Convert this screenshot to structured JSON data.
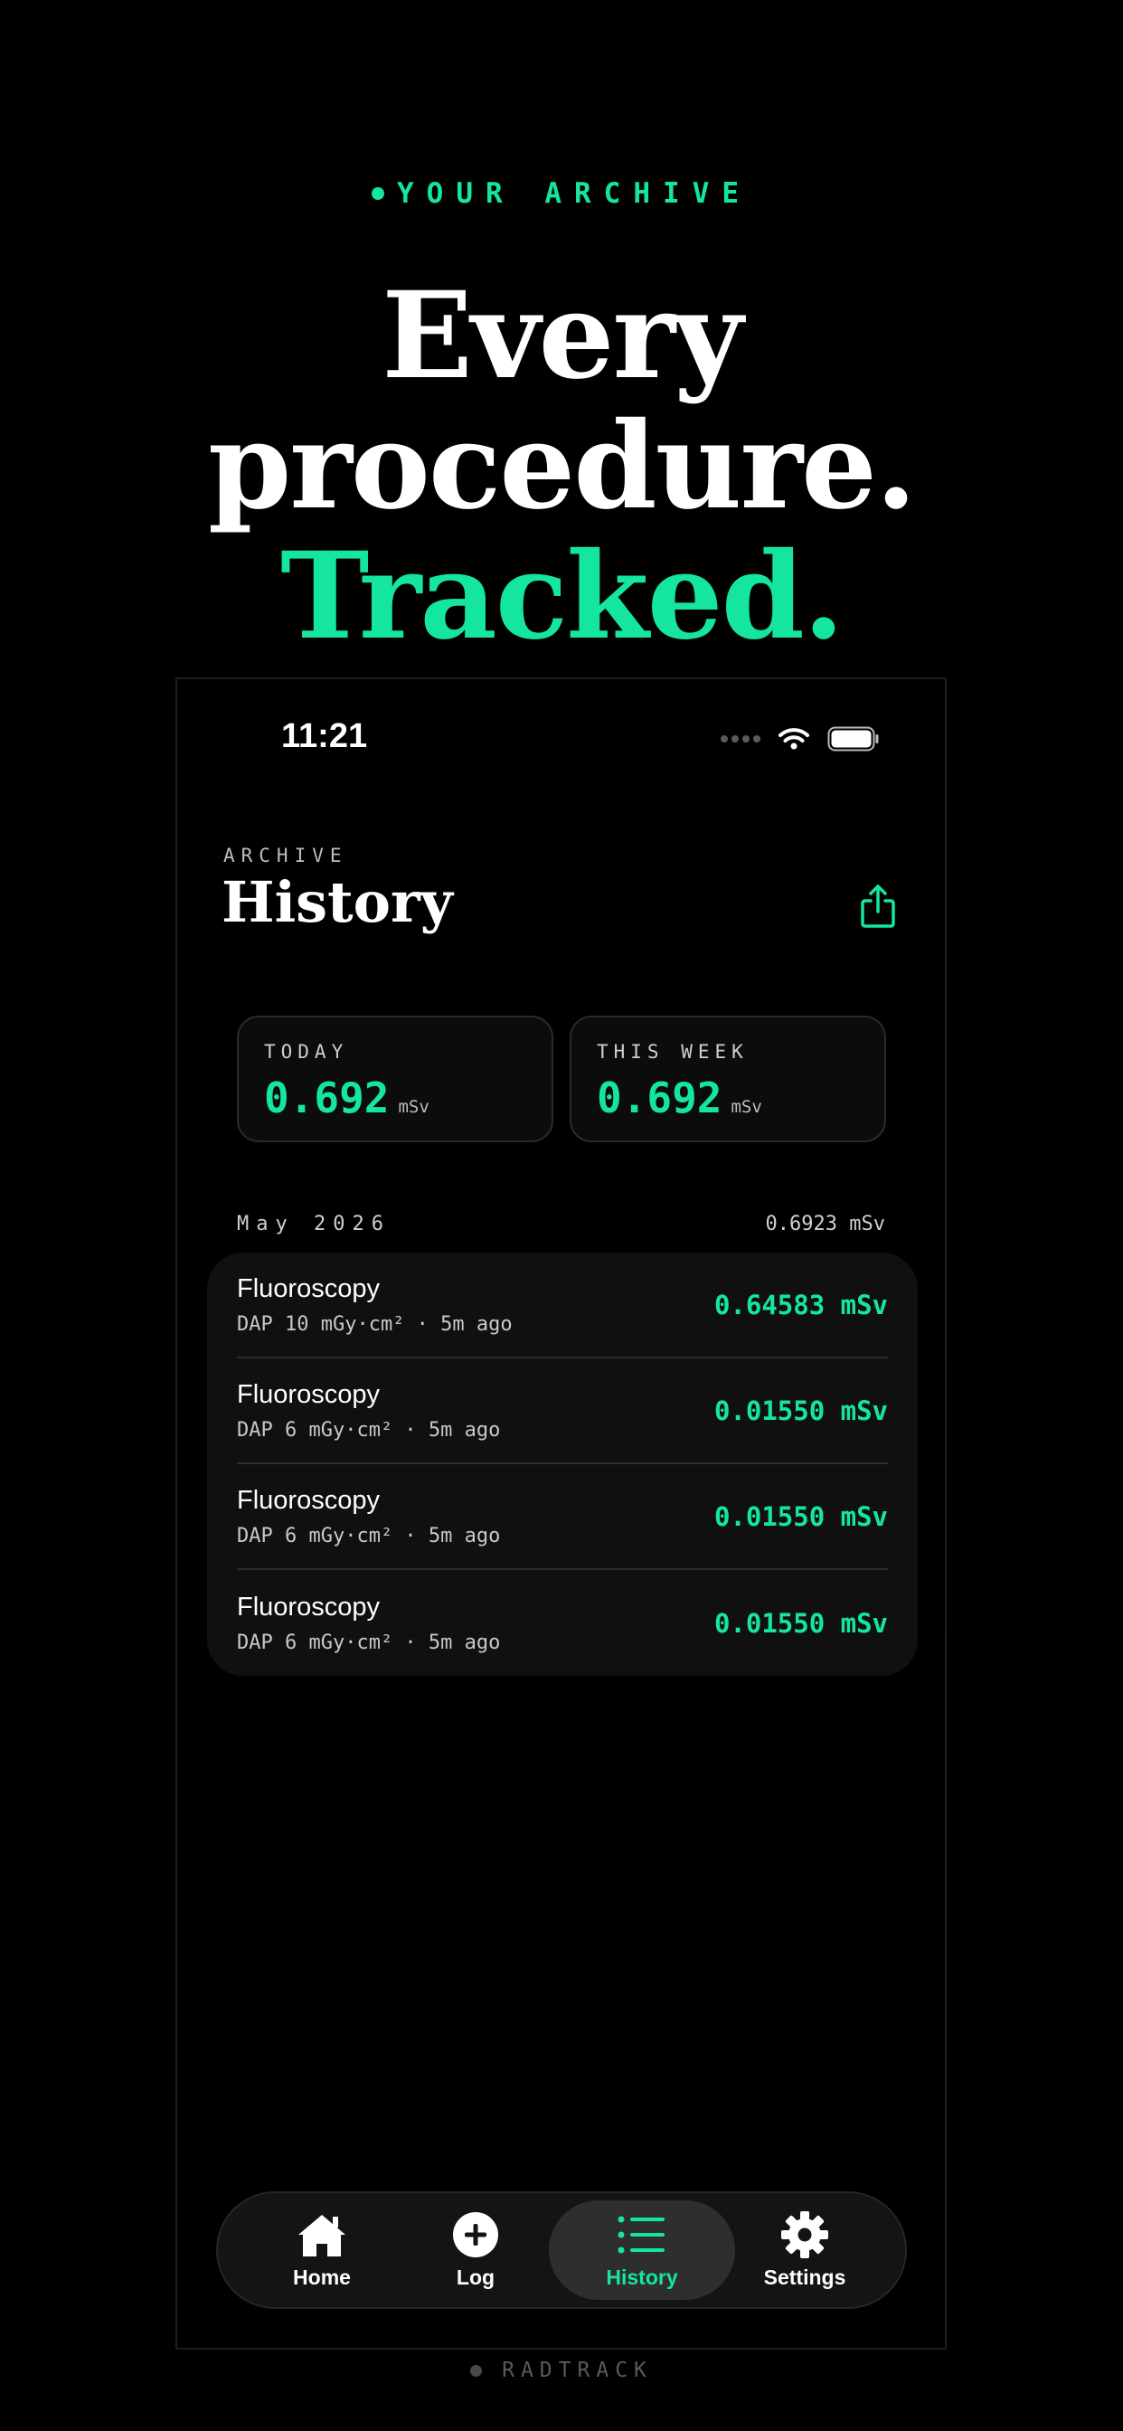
{
  "hero": {
    "eyebrow": "YOUR ARCHIVE",
    "line1": "Every",
    "line2": "procedure.",
    "line3": "Tracked."
  },
  "status_bar": {
    "time": "11:21"
  },
  "header": {
    "eyebrow": "ARCHIVE",
    "title": "History",
    "share_icon": "share-icon"
  },
  "stats": [
    {
      "label": "TODAY",
      "value": "0.692",
      "unit": "mSv"
    },
    {
      "label": "THIS WEEK",
      "value": "0.692",
      "unit": "mSv"
    }
  ],
  "month": {
    "label": "May 2026",
    "total": "0.6923 mSv"
  },
  "entries": [
    {
      "name": "Fluoroscopy",
      "meta": "DAP 10 mGy·cm² · 5m ago",
      "dose": "0.64583 mSv"
    },
    {
      "name": "Fluoroscopy",
      "meta": "DAP 6 mGy·cm² · 5m ago",
      "dose": "0.01550 mSv"
    },
    {
      "name": "Fluoroscopy",
      "meta": "DAP 6 mGy·cm² · 5m ago",
      "dose": "0.01550 mSv"
    },
    {
      "name": "Fluoroscopy",
      "meta": "DAP 6 mGy·cm² · 5m ago",
      "dose": "0.01550 mSv"
    }
  ],
  "tabs": [
    {
      "label": "Home",
      "icon": "house-icon",
      "active": false
    },
    {
      "label": "Log",
      "icon": "plus-circle-icon",
      "active": false
    },
    {
      "label": "History",
      "icon": "list-icon",
      "active": true
    },
    {
      "label": "Settings",
      "icon": "gear-icon",
      "active": false
    }
  ],
  "footer": {
    "brand": "RADTRACK"
  },
  "colors": {
    "accent": "#14e6a0",
    "background": "#000000",
    "card": "#101010"
  }
}
